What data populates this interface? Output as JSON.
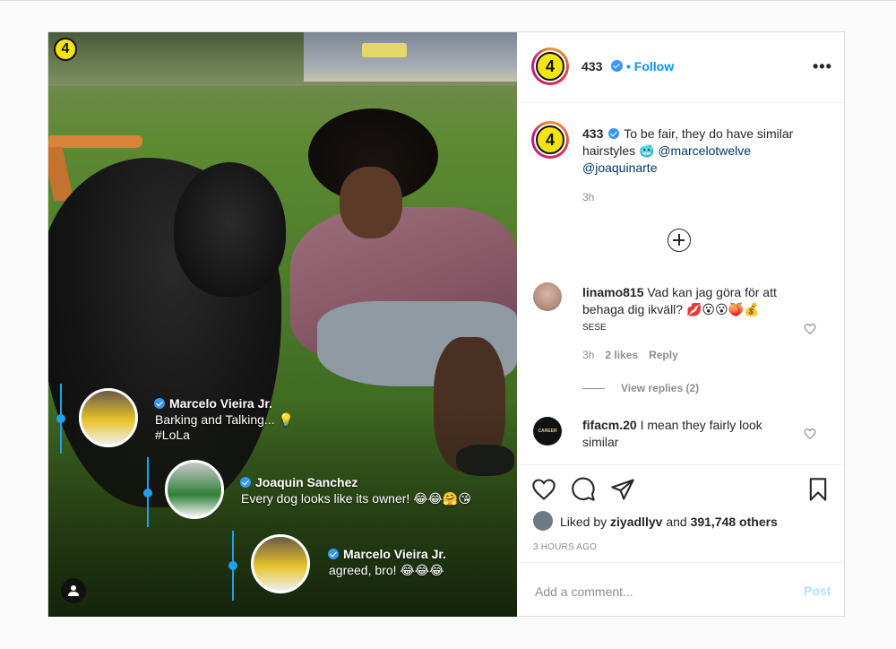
{
  "colors": {
    "accent": "#0095f6",
    "link": "#00376b",
    "verified": "#3897f0",
    "overlay_line": "#1da1f2",
    "brand_yellow": "#f4e511"
  },
  "photo": {
    "corner_logo": "4",
    "overlay_comments": [
      {
        "name": "Marcelo Vieira Jr.",
        "line1": "Barking and Talking... 💡",
        "line2": "#LoLa"
      },
      {
        "name": "Joaquin Sanchez",
        "line1": "Every dog looks like its owner! 😂😂🤗😘"
      },
      {
        "name": "Marcelo Vieira Jr.",
        "line1": "agreed, bro! 😂😂😂"
      }
    ],
    "user_tag_icon": "user-icon"
  },
  "header": {
    "avatar_logo": "4",
    "username": "433",
    "separator": "•",
    "follow_label": "Follow",
    "more_label": "•••"
  },
  "caption": {
    "avatar_logo": "4",
    "username": "433",
    "text": "To be fair, they do have similar hairstyles 🥶",
    "mention1": "@marcelotwelve",
    "mention2": "@joaquinarte",
    "time": "3h"
  },
  "comments": [
    {
      "username": "linamo815",
      "text": "Vad kan jag göra för att behaga dig ikväll? 💋😮😮🍑💰",
      "subtext": "SESE",
      "time": "3h",
      "likes": "2 likes",
      "reply": "Reply",
      "view_replies": "View replies (2)"
    },
    {
      "username": "fifacm.20",
      "text": "I mean they fairly look similar",
      "avatar_text": "CAREER MODE"
    }
  ],
  "actions": {
    "like_icon": "heart-icon",
    "comment_icon": "comment-icon",
    "share_icon": "share-icon",
    "save_icon": "bookmark-icon",
    "liked_by_prefix": "Liked by",
    "liked_by_user": "ziyadllyv",
    "liked_by_and": "and",
    "liked_by_count": "391,748 others",
    "time_ago": "3 HOURS AGO"
  },
  "add_comment": {
    "placeholder": "Add a comment...",
    "post_label": "Post"
  }
}
